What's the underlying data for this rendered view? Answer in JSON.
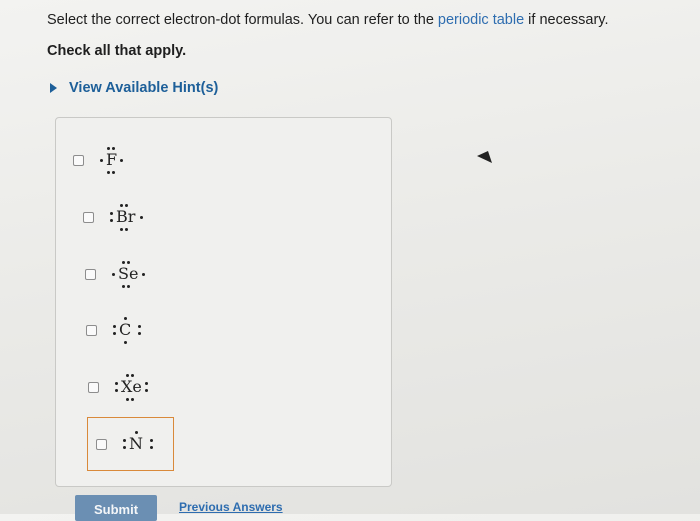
{
  "instruction": {
    "before": "Select the correct electron-dot formulas. You can refer to the ",
    "link": "periodic table",
    "after": " if necessary."
  },
  "check_all": "Check all that apply.",
  "hint_label": "View Available Hint(s)",
  "options": [
    {
      "symbol": "F",
      "checked": false
    },
    {
      "symbol": "Br",
      "checked": false
    },
    {
      "symbol": "Se",
      "checked": false
    },
    {
      "symbol": "C",
      "checked": false
    },
    {
      "symbol": "Xe",
      "checked": false
    },
    {
      "symbol": "N",
      "checked": false
    }
  ],
  "submit_label": "Submit",
  "previous_answers_label": "Previous Answers"
}
